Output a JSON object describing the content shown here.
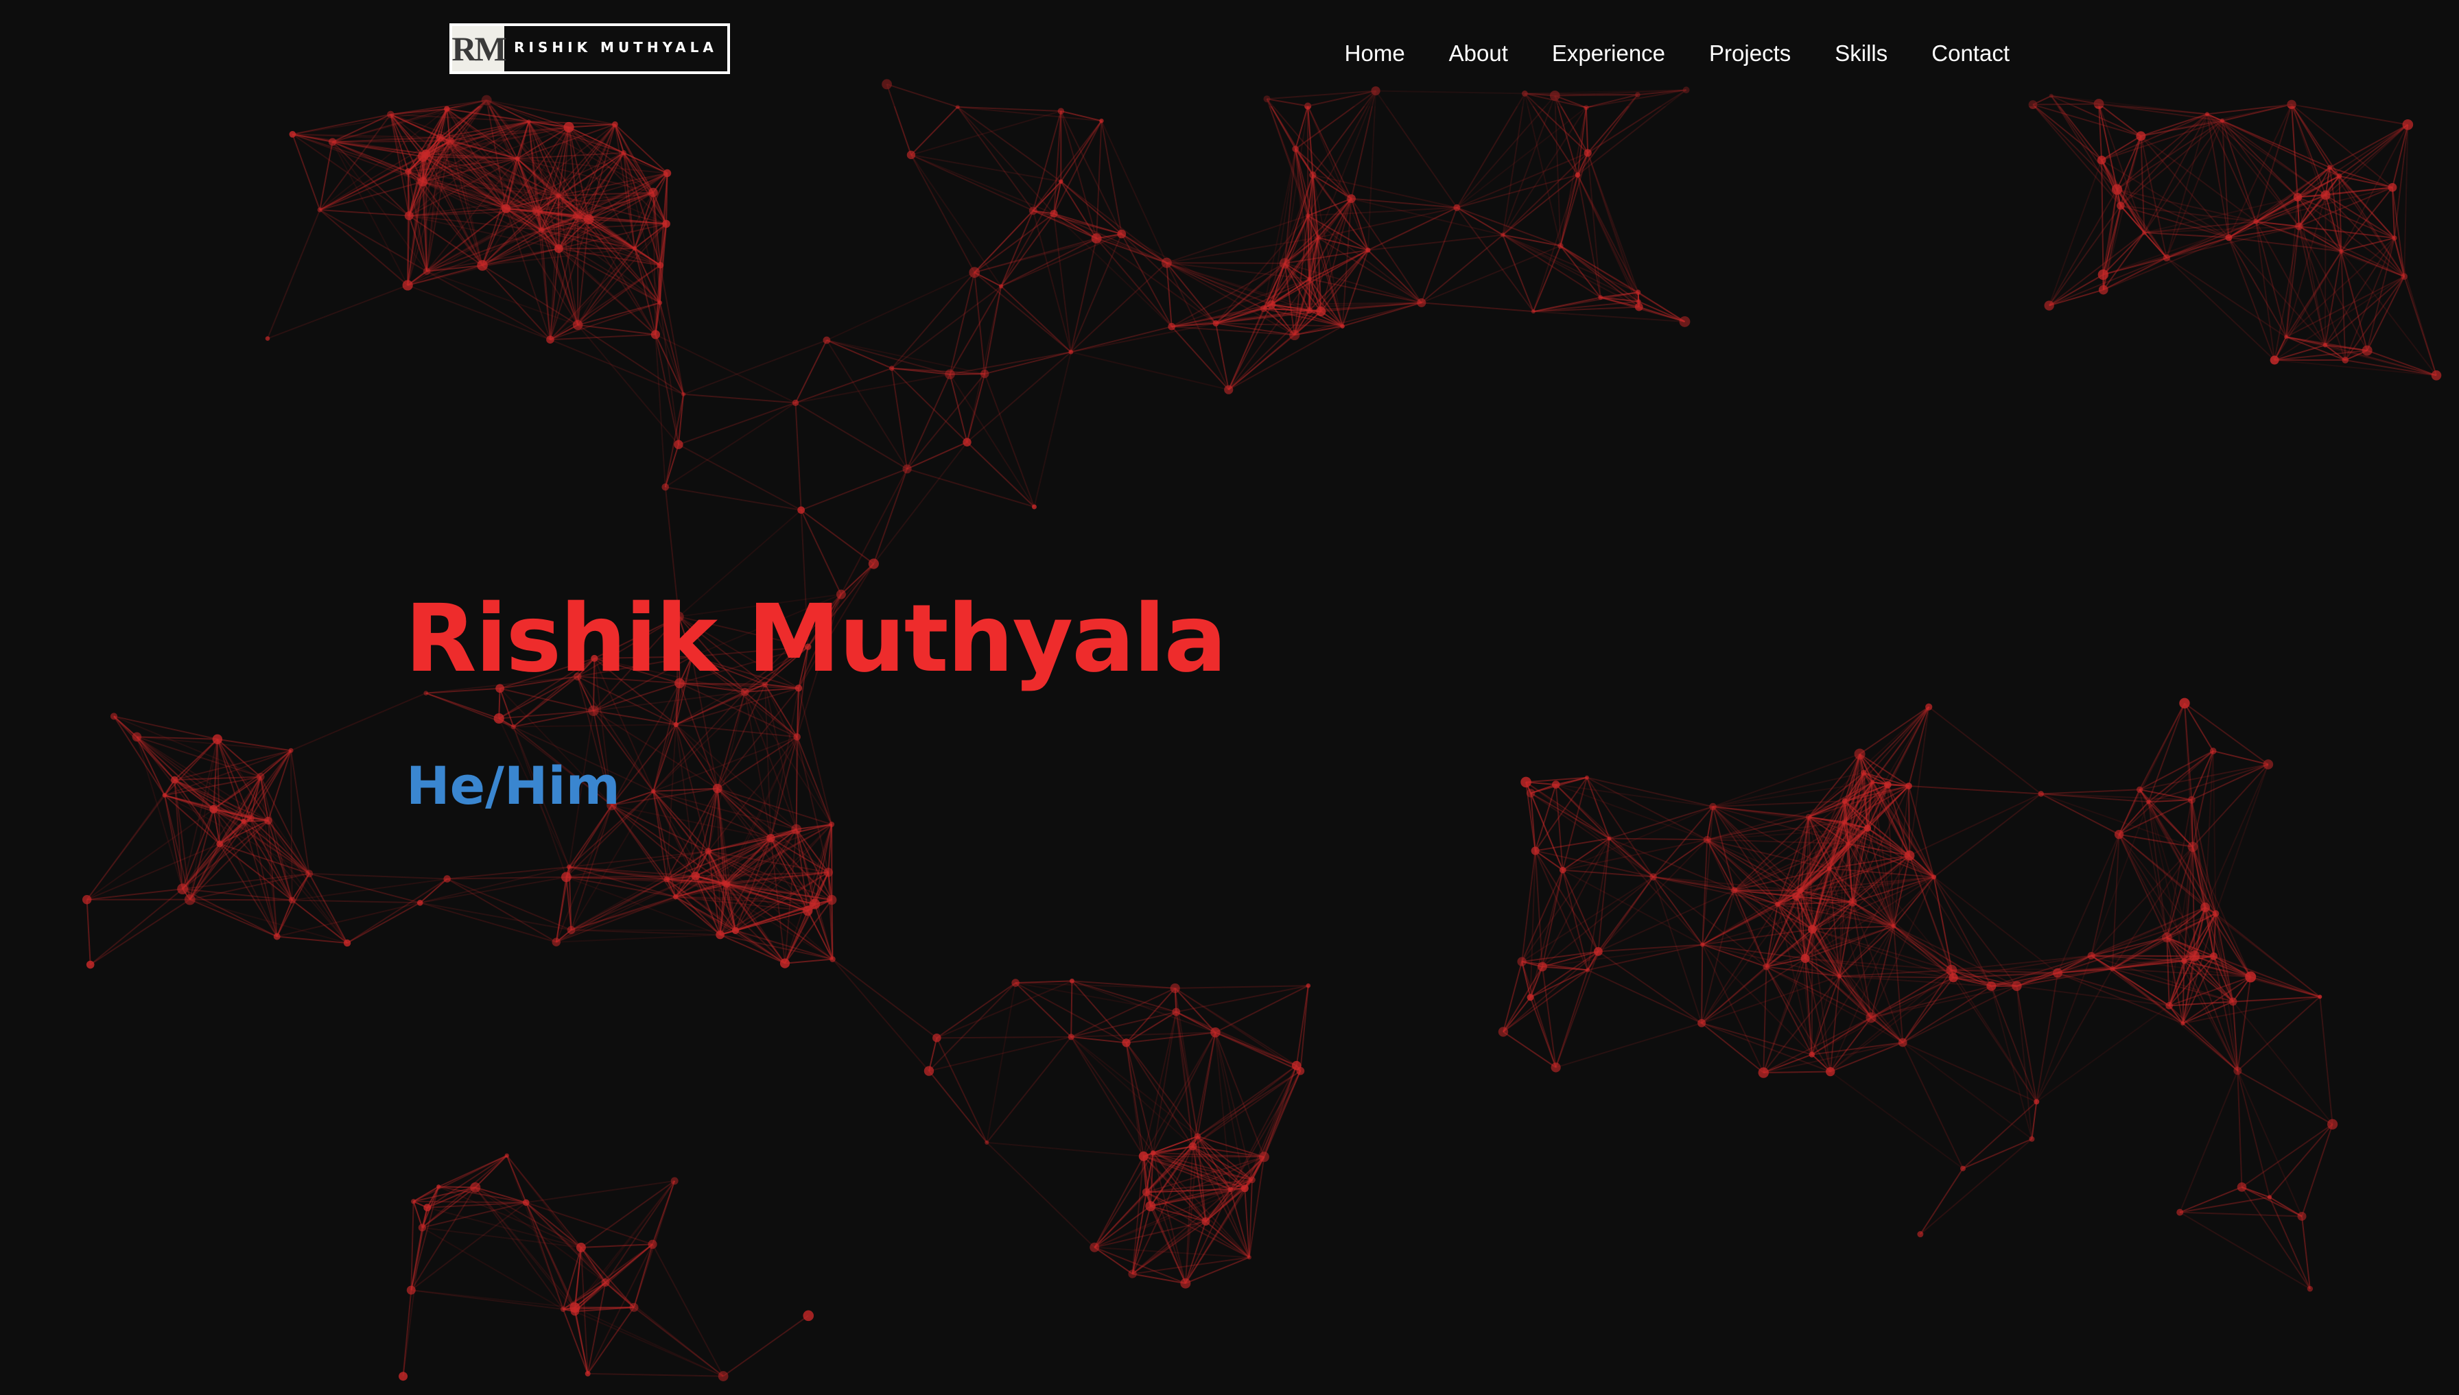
{
  "brand": {
    "monogram": "RM",
    "name": "RISHIK MUTHYALA"
  },
  "nav": {
    "items": [
      {
        "label": "Home"
      },
      {
        "label": "About"
      },
      {
        "label": "Experience"
      },
      {
        "label": "Projects"
      },
      {
        "label": "Skills"
      },
      {
        "label": "Contact"
      }
    ]
  },
  "hero": {
    "title": "Rishik Muthyala",
    "pronouns": "He/Him"
  },
  "colors": {
    "background": "#0d0d0d",
    "title": "#ee2c2c",
    "pronouns": "#3a86d0",
    "particles": "#c62828"
  }
}
